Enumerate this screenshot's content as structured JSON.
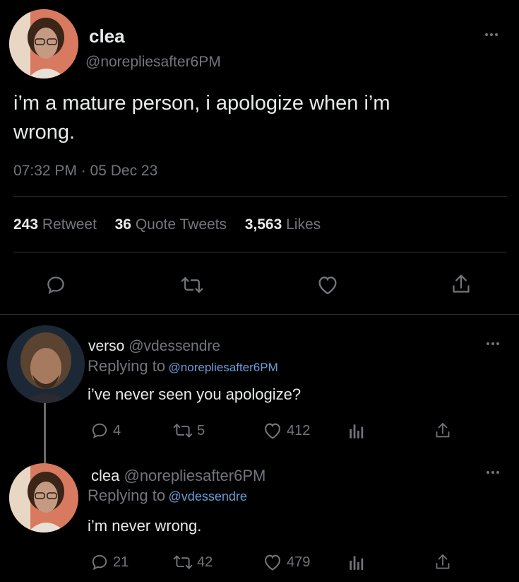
{
  "main_tweet": {
    "name": "clea",
    "handle": "@norepliesafter6PM",
    "text_line1": "i’m a mature person, i apologize when i’m",
    "text_line2": "wrong.",
    "timestamp": "07:32 PM · 05 Dec 23",
    "stats": {
      "retweets": "243",
      "retweets_label": "Retweet",
      "quotes": "36",
      "quotes_label": "Quote Tweets",
      "likes": "3,563",
      "likes_label": "Likes"
    }
  },
  "replies": [
    {
      "name": "verso",
      "handle": "@vdessendre",
      "replying_label": "Replying to",
      "replying_to": "@norepliesafter6PM",
      "text": "i’ve never seen you apologize?",
      "replies": "4",
      "retweets": "5",
      "likes": "412"
    },
    {
      "name": "clea",
      "handle": "@norepliesafter6PM",
      "replying_label": "Replying to",
      "replying_to": "@vdessendre",
      "text": "i’m never wrong.",
      "replies": "21",
      "retweets": "42",
      "likes": "479"
    }
  ],
  "colors": {
    "background": "#000000",
    "text": "#e7e9ea",
    "muted": "#71767b",
    "link": "#6b9fd6",
    "divider": "#2f3336"
  }
}
